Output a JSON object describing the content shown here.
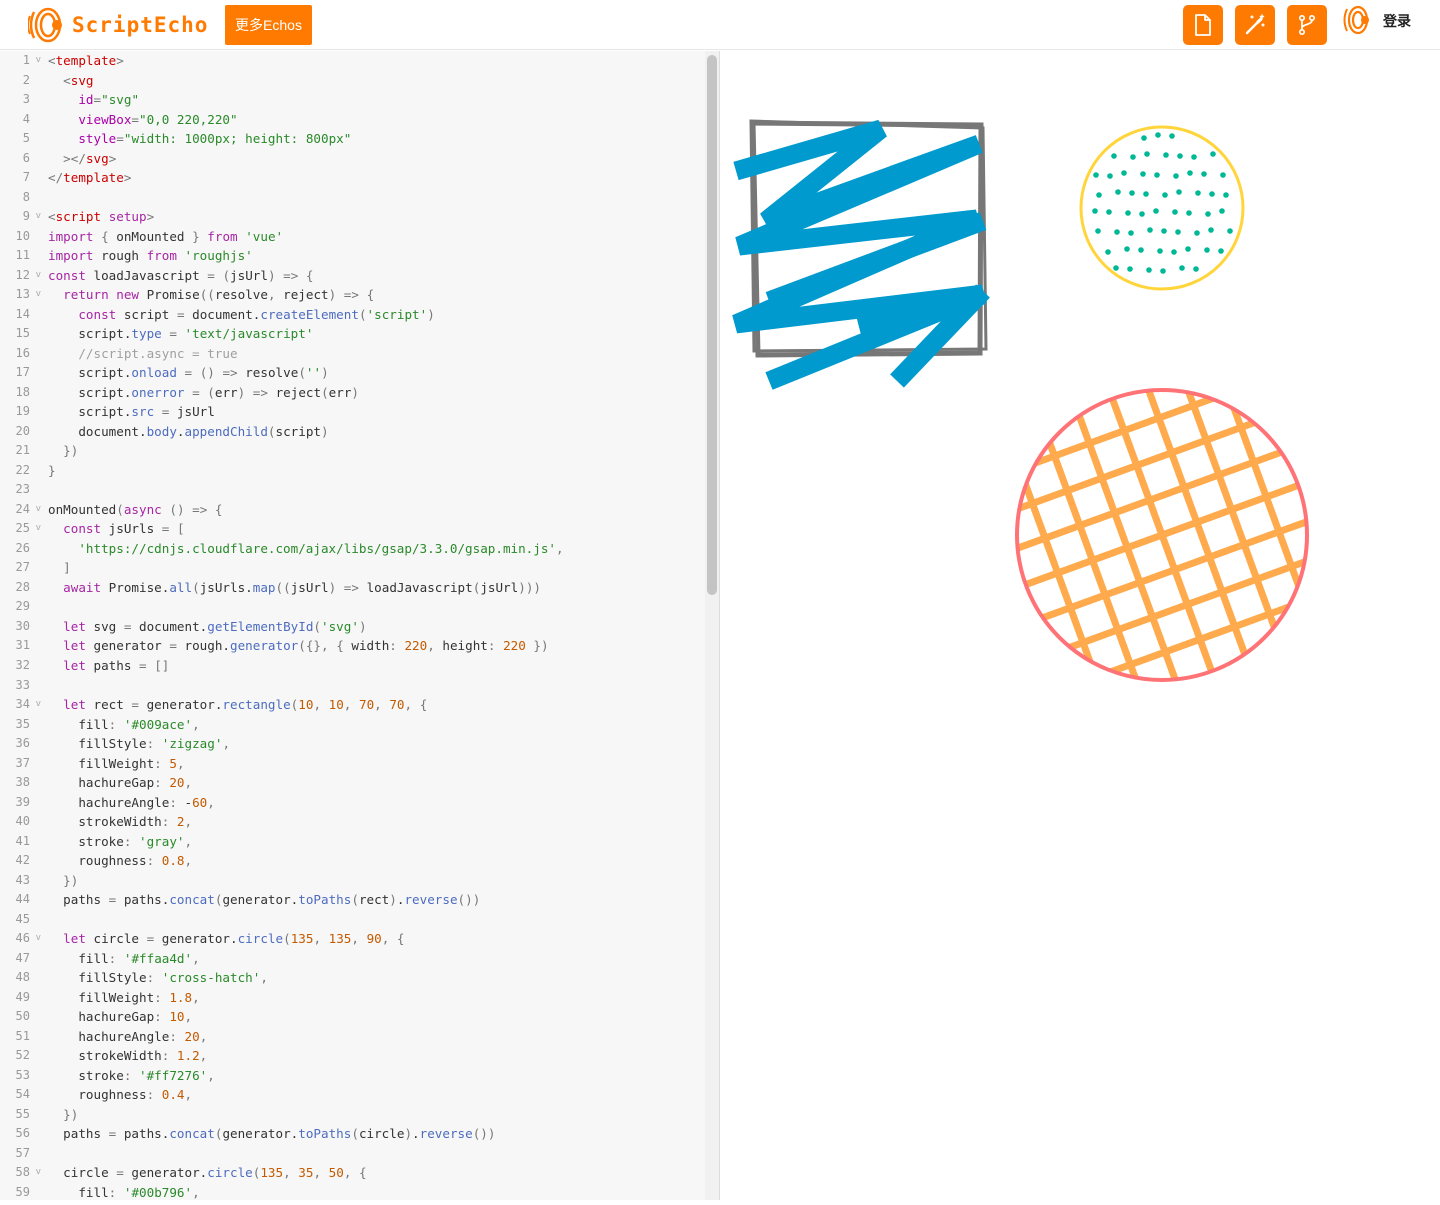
{
  "header": {
    "brand": "ScriptEcho",
    "more_label": "更多Echos",
    "login_label": "登录",
    "tools": [
      {
        "icon": "file-icon"
      },
      {
        "icon": "magic-wand-icon"
      },
      {
        "icon": "branch-icon"
      }
    ]
  },
  "colors": {
    "accent": "#ff7a00",
    "rect_fill": "#009ace",
    "rect_stroke": "gray",
    "circle_fill": "#ffaa4d",
    "circle_stroke": "#ff7276",
    "small_fill": "#00b796",
    "small_stroke": "#ffd53b"
  },
  "code": {
    "lines": [
      "<template>",
      "  <svg",
      "    id=\"svg\"",
      "    viewBox=\"0,0 220,220\"",
      "    style=\"width: 1000px; height: 800px\"",
      "  ></svg>",
      "</template>",
      "",
      "<script setup>",
      "import { onMounted } from 'vue'",
      "import rough from 'roughjs'",
      "const loadJavascript = (jsUrl) => {",
      "  return new Promise((resolve, reject) => {",
      "    const script = document.createElement('script')",
      "    script.type = 'text/javascript'",
      "    //script.async = true",
      "    script.onload = () => resolve('')",
      "    script.onerror = (err) => reject(err)",
      "    script.src = jsUrl",
      "    document.body.appendChild(script)",
      "  })",
      "}",
      "",
      "onMounted(async () => {",
      "  const jsUrls = [",
      "    'https://cdnjs.cloudflare.com/ajax/libs/gsap/3.3.0/gsap.min.js',",
      "  ]",
      "  await Promise.all(jsUrls.map((jsUrl) => loadJavascript(jsUrl)))",
      "",
      "  let svg = document.getElementById('svg')",
      "  let generator = rough.generator({}, { width: 220, height: 220 })",
      "  let paths = []",
      "",
      "  let rect = generator.rectangle(10, 10, 70, 70, {",
      "    fill: '#009ace',",
      "    fillStyle: 'zigzag',",
      "    fillWeight: 5,",
      "    hachureGap: 20,",
      "    hachureAngle: -60,",
      "    strokeWidth: 2,",
      "    stroke: 'gray',",
      "    roughness: 0.8,",
      "  })",
      "  paths = paths.concat(generator.toPaths(rect).reverse())",
      "",
      "  let circle = generator.circle(135, 135, 90, {",
      "    fill: '#ffaa4d',",
      "    fillStyle: 'cross-hatch',",
      "    fillWeight: 1.8,",
      "    hachureGap: 10,",
      "    hachureAngle: 20,",
      "    strokeWidth: 1.2,",
      "    stroke: '#ff7276',",
      "    roughness: 0.4,",
      "  })",
      "  paths = paths.concat(generator.toPaths(circle).reverse())",
      "",
      "  circle = generator.circle(135, 35, 50, {",
      "    fill: '#00b796',"
    ],
    "fold_lines": [
      1,
      9,
      12,
      13,
      24,
      25,
      34,
      46,
      58
    ]
  }
}
